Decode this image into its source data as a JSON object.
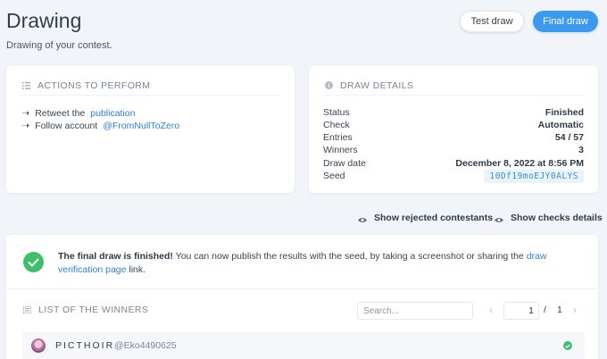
{
  "header": {
    "title": "Drawing",
    "subtitle": "Drawing of your contest.",
    "test_draw_label": "Test draw",
    "final_draw_label": "Final draw"
  },
  "actions_card": {
    "title": "ACTIONS TO PERFORM",
    "items": [
      {
        "prefix": "Retweet the",
        "link": "publication"
      },
      {
        "prefix": "Follow account",
        "link": "@FromNullToZero"
      }
    ]
  },
  "details_card": {
    "title": "DRAW DETAILS",
    "rows": [
      {
        "label": "Status",
        "value": "Finished"
      },
      {
        "label": "Check",
        "value": "Automatic"
      },
      {
        "label": "Entries",
        "value": "54 / 57"
      },
      {
        "label": "Winners",
        "value": "3"
      },
      {
        "label": "Draw date",
        "value": "December 8, 2022 at 8:56 PM"
      },
      {
        "label": "Seed",
        "value": "10Df19moEJY0ALYS"
      }
    ]
  },
  "toggles": {
    "rejected": "Show rejected contestants",
    "checks": "Show checks details"
  },
  "notice": {
    "bold": "The final draw is finished!",
    "text": " You can now publish the results with the seed, by taking a screenshot or sharing the ",
    "link": "draw verification page",
    "suffix": " link."
  },
  "winners": {
    "title": "LIST OF THE WINNERS",
    "search_placeholder": "Search...",
    "page_current": "1",
    "page_separator": "/",
    "page_total": "1",
    "rows": [
      {
        "name": "PICTHOIR",
        "handle": "@Eko4490625"
      }
    ]
  },
  "colors": {
    "accent": "#3b9af0",
    "success": "#3fbf6a",
    "link": "#2f80d5",
    "background": "#f1f5f9"
  },
  "icons": {
    "actions": "list-icon",
    "details": "info-icon",
    "toggle": "eye-icon",
    "success": "check-circle-icon",
    "winners": "list-icon",
    "pager_prev": "chevron-left-icon",
    "pager_next": "chevron-right-icon"
  }
}
